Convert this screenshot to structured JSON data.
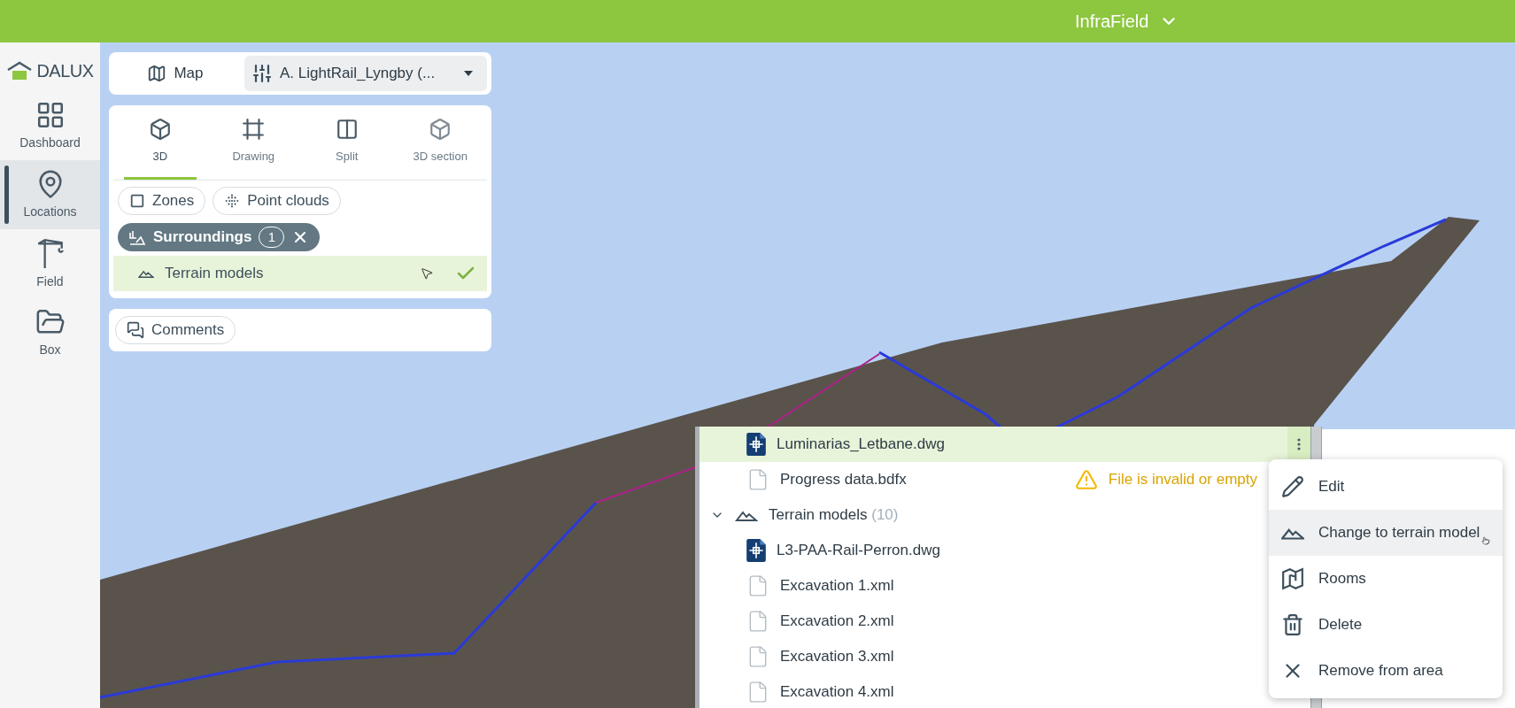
{
  "top_bar": {
    "title": "InfraField"
  },
  "sidebar": {
    "logo": "DALUX",
    "items": [
      {
        "label": "Dashboard",
        "selected": false
      },
      {
        "label": "Locations",
        "selected": true
      },
      {
        "label": "Field",
        "selected": false
      },
      {
        "label": "Box",
        "selected": false
      }
    ]
  },
  "view_bar": {
    "map_button": "Map",
    "model_select": "A. LightRail_Lyngby (..."
  },
  "view_tabs": [
    {
      "label": "3D",
      "selected": true
    },
    {
      "label": "Drawing",
      "selected": false
    },
    {
      "label": "Split",
      "selected": false
    },
    {
      "label": "3D section",
      "selected": false
    }
  ],
  "filters": [
    {
      "label": "Zones"
    },
    {
      "label": "Point clouds"
    }
  ],
  "surroundings_chip": {
    "label": "Surroundings",
    "count": "1"
  },
  "surroundings_items": [
    {
      "label": "Terrain models",
      "checked": true
    }
  ],
  "comments_button": "Comments",
  "file_list": [
    {
      "kind": "drawing",
      "name": "Luminarias_Letbane.dwg",
      "selected": true
    },
    {
      "kind": "document",
      "name": "Progress data.bdfx",
      "selected": false,
      "warning": "File is invalid or empty"
    },
    {
      "kind": "group",
      "name": "Terrain models",
      "count": "(10)",
      "expanded": true
    },
    {
      "kind": "drawing",
      "name": "L3-PAA-Rail-Perron.dwg",
      "selected": false
    },
    {
      "kind": "document",
      "name": "Excavation 1.xml",
      "selected": false
    },
    {
      "kind": "document",
      "name": "Excavation 2.xml",
      "selected": false
    },
    {
      "kind": "document",
      "name": "Excavation 3.xml",
      "selected": false
    },
    {
      "kind": "document",
      "name": "Excavation 4.xml",
      "selected": false
    }
  ],
  "context_menu": [
    {
      "label": "Edit",
      "selected": false
    },
    {
      "label": "Change to terrain model",
      "selected": true
    },
    {
      "label": "Rooms",
      "selected": false
    },
    {
      "label": "Delete",
      "selected": false
    },
    {
      "label": "Remove from area",
      "selected": false
    }
  ]
}
